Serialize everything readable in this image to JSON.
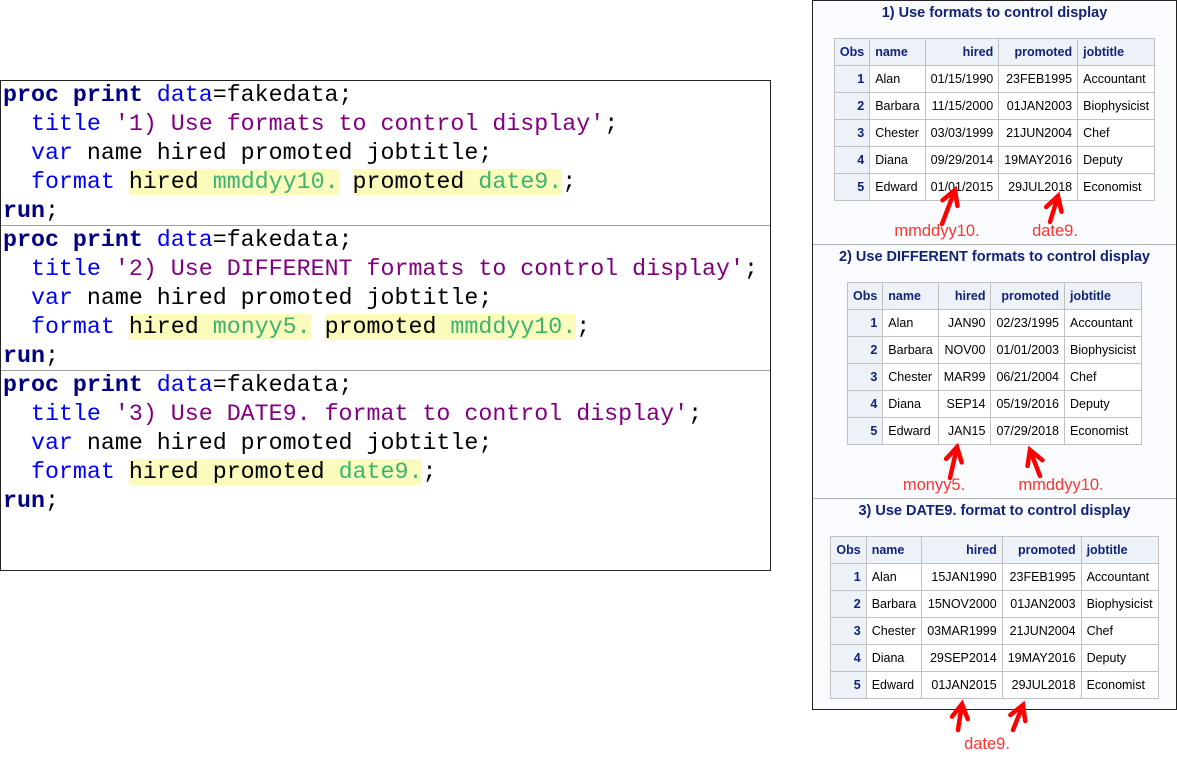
{
  "code_blocks": [
    {
      "lines": [
        [
          {
            "c": "kw",
            "s": "proc"
          },
          {
            "c": "txt",
            "s": " "
          },
          {
            "c": "kw",
            "s": "print"
          },
          {
            "c": "txt",
            "s": " "
          },
          {
            "c": "st",
            "s": "data"
          },
          {
            "c": "txt",
            "s": "=fakedata;"
          }
        ],
        [
          {
            "c": "txt",
            "s": "  "
          },
          {
            "c": "st",
            "s": "title"
          },
          {
            "c": "txt",
            "s": " "
          },
          {
            "c": "str",
            "s": "'1) Use formats to control display'"
          },
          {
            "c": "txt",
            "s": ";"
          }
        ],
        [
          {
            "c": "txt",
            "s": "  "
          },
          {
            "c": "st",
            "s": "var"
          },
          {
            "c": "txt",
            "s": " name hired promoted jobtitle;"
          }
        ],
        [
          {
            "c": "txt",
            "s": "  "
          },
          {
            "c": "st",
            "s": "format"
          },
          {
            "c": "txt",
            "s": " "
          },
          {
            "c": "txt",
            "s": "hired ",
            "hl": 1
          },
          {
            "c": "fmt",
            "s": "mmddyy10.",
            "hl": 1
          },
          {
            "c": "txt",
            "s": " "
          },
          {
            "c": "txt",
            "s": "promoted ",
            "hl": 2
          },
          {
            "c": "fmt",
            "s": "date9.",
            "hl": 2
          },
          {
            "c": "txt",
            "s": ";"
          }
        ],
        [
          {
            "c": "kw",
            "s": "run"
          },
          {
            "c": "txt",
            "s": ";"
          }
        ]
      ]
    },
    {
      "lines": [
        [
          {
            "c": "kw",
            "s": "proc"
          },
          {
            "c": "txt",
            "s": " "
          },
          {
            "c": "kw",
            "s": "print"
          },
          {
            "c": "txt",
            "s": " "
          },
          {
            "c": "st",
            "s": "data"
          },
          {
            "c": "txt",
            "s": "=fakedata;"
          }
        ],
        [
          {
            "c": "txt",
            "s": "  "
          },
          {
            "c": "st",
            "s": "title"
          },
          {
            "c": "txt",
            "s": " "
          },
          {
            "c": "str",
            "s": "'2) Use DIFFERENT formats to control display'"
          },
          {
            "c": "txt",
            "s": ";"
          }
        ],
        [
          {
            "c": "txt",
            "s": "  "
          },
          {
            "c": "st",
            "s": "var"
          },
          {
            "c": "txt",
            "s": " name hired promoted jobtitle;"
          }
        ],
        [
          {
            "c": "txt",
            "s": "  "
          },
          {
            "c": "st",
            "s": "format"
          },
          {
            "c": "txt",
            "s": " "
          },
          {
            "c": "txt",
            "s": "hired ",
            "hl": 1
          },
          {
            "c": "fmt",
            "s": "monyy5.",
            "hl": 1
          },
          {
            "c": "txt",
            "s": " "
          },
          {
            "c": "txt",
            "s": "promoted ",
            "hl": 2
          },
          {
            "c": "fmt",
            "s": "mmddyy10.",
            "hl": 2
          },
          {
            "c": "txt",
            "s": ";"
          }
        ],
        [
          {
            "c": "kw",
            "s": "run"
          },
          {
            "c": "txt",
            "s": ";"
          }
        ]
      ]
    },
    {
      "lines": [
        [
          {
            "c": "kw",
            "s": "proc"
          },
          {
            "c": "txt",
            "s": " "
          },
          {
            "c": "kw",
            "s": "print"
          },
          {
            "c": "txt",
            "s": " "
          },
          {
            "c": "st",
            "s": "data"
          },
          {
            "c": "txt",
            "s": "=fakedata;"
          }
        ],
        [
          {
            "c": "txt",
            "s": "  "
          },
          {
            "c": "st",
            "s": "title"
          },
          {
            "c": "txt",
            "s": " "
          },
          {
            "c": "str",
            "s": "'3) Use DATE9. format to control display'"
          },
          {
            "c": "txt",
            "s": ";"
          }
        ],
        [
          {
            "c": "txt",
            "s": "  "
          },
          {
            "c": "st",
            "s": "var"
          },
          {
            "c": "txt",
            "s": " name hired promoted jobtitle;"
          }
        ],
        [
          {
            "c": "txt",
            "s": "  "
          },
          {
            "c": "st",
            "s": "format"
          },
          {
            "c": "txt",
            "s": " "
          },
          {
            "c": "txt",
            "s": "hired promoted ",
            "hl": 1
          },
          {
            "c": "fmt",
            "s": "date9.",
            "hl": 1
          },
          {
            "c": "txt",
            "s": ";"
          }
        ],
        [
          {
            "c": "kw",
            "s": "run"
          },
          {
            "c": "txt",
            "s": ";"
          }
        ]
      ]
    }
  ],
  "outputs": [
    {
      "title": "1) Use formats to control display",
      "headers": [
        "Obs",
        "name",
        "hired",
        "promoted",
        "jobtitle"
      ],
      "rows": [
        [
          "1",
          "Alan",
          "01/15/1990",
          "23FEB1995",
          "Accountant"
        ],
        [
          "2",
          "Barbara",
          "11/15/2000",
          "01JAN2003",
          "Biophysicist"
        ],
        [
          "3",
          "Chester",
          "03/03/1999",
          "21JUN2004",
          "Chef"
        ],
        [
          "4",
          "Diana",
          "09/29/2014",
          "19MAY2016",
          "Deputy"
        ],
        [
          "5",
          "Edward",
          "01/01/2015",
          "29JUL2018",
          "Economist"
        ]
      ]
    },
    {
      "title": "2) Use DIFFERENT formats to control display",
      "headers": [
        "Obs",
        "name",
        "hired",
        "promoted",
        "jobtitle"
      ],
      "rows": [
        [
          "1",
          "Alan",
          "JAN90",
          "02/23/1995",
          "Accountant"
        ],
        [
          "2",
          "Barbara",
          "NOV00",
          "01/01/2003",
          "Biophysicist"
        ],
        [
          "3",
          "Chester",
          "MAR99",
          "06/21/2004",
          "Chef"
        ],
        [
          "4",
          "Diana",
          "SEP14",
          "05/19/2016",
          "Deputy"
        ],
        [
          "5",
          "Edward",
          "JAN15",
          "07/29/2018",
          "Economist"
        ]
      ]
    },
    {
      "title": "3) Use DATE9. format to control display",
      "headers": [
        "Obs",
        "name",
        "hired",
        "promoted",
        "jobtitle"
      ],
      "rows": [
        [
          "1",
          "Alan",
          "15JAN1990",
          "23FEB1995",
          "Accountant"
        ],
        [
          "2",
          "Barbara",
          "15NOV2000",
          "01JAN2003",
          "Biophysicist"
        ],
        [
          "3",
          "Chester",
          "03MAR1999",
          "21JUN2004",
          "Chef"
        ],
        [
          "4",
          "Diana",
          "29SEP2014",
          "19MAY2016",
          "Deputy"
        ],
        [
          "5",
          "Edward",
          "01JAN2015",
          "29JUL2018",
          "Economist"
        ]
      ]
    }
  ],
  "annotations": [
    "mmddyy10.",
    "date9.",
    "monyy5.",
    "mmddyy10.",
    "date9."
  ],
  "colors": {
    "annotation": "#ff3333",
    "keyword": "#000080",
    "statement": "#0000ff",
    "string": "#800080",
    "format": "#3cb371",
    "highlight": "#fbfbbc",
    "header_bg": "#edf2f9",
    "header_text": "#112277"
  }
}
